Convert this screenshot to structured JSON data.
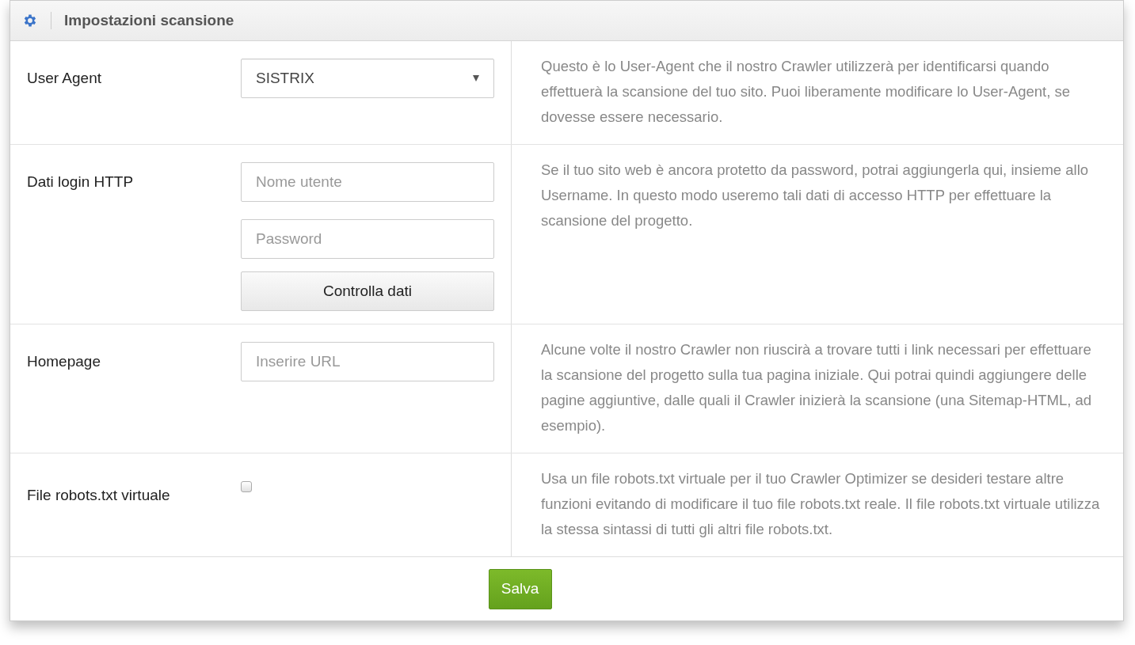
{
  "panel": {
    "title": "Impostazioni scansione"
  },
  "rows": [
    {
      "kind": "select",
      "label": "User Agent",
      "value": "SISTRIX",
      "description": "Questo è lo User-Agent che il nostro Crawler utilizzerà per identificarsi quando effettuerà la scansione del tuo sito. Puoi liberamente modificare lo User-Agent, se dovesse essere necessario."
    },
    {
      "kind": "login",
      "label": "Dati login HTTP",
      "username_placeholder": "Nome utente",
      "password_placeholder": "Password",
      "button": "Controlla dati",
      "description": "Se il tuo sito web è ancora protetto da password, potrai aggiungerla qui, insieme allo Username. In questo modo useremo tali dati di accesso HTTP per effettuare la scansione del progetto."
    },
    {
      "kind": "text",
      "label": "Homepage",
      "placeholder": "Inserire URL",
      "description": "Alcune volte il nostro Crawler non riuscirà a trovare tutti i link necessari per effettuare la scansione del progetto sulla tua pagina iniziale. Qui potrai quindi aggiungere delle pagine aggiuntive, dalle quali il Crawler inizierà la scansione (una Sitemap-HTML, ad esempio)."
    },
    {
      "kind": "checkbox",
      "label": "File robots.txt virtuale",
      "checked": false,
      "description": "Usa un file robots.txt virtuale per il tuo Crawler Optimizer se desideri testare altre funzioni evitando di modificare il tuo file robots.txt reale. Il file robots.txt virtuale utilizza la stessa sintassi di tutti gli altri file robots.txt."
    }
  ],
  "save_button": "Salva"
}
